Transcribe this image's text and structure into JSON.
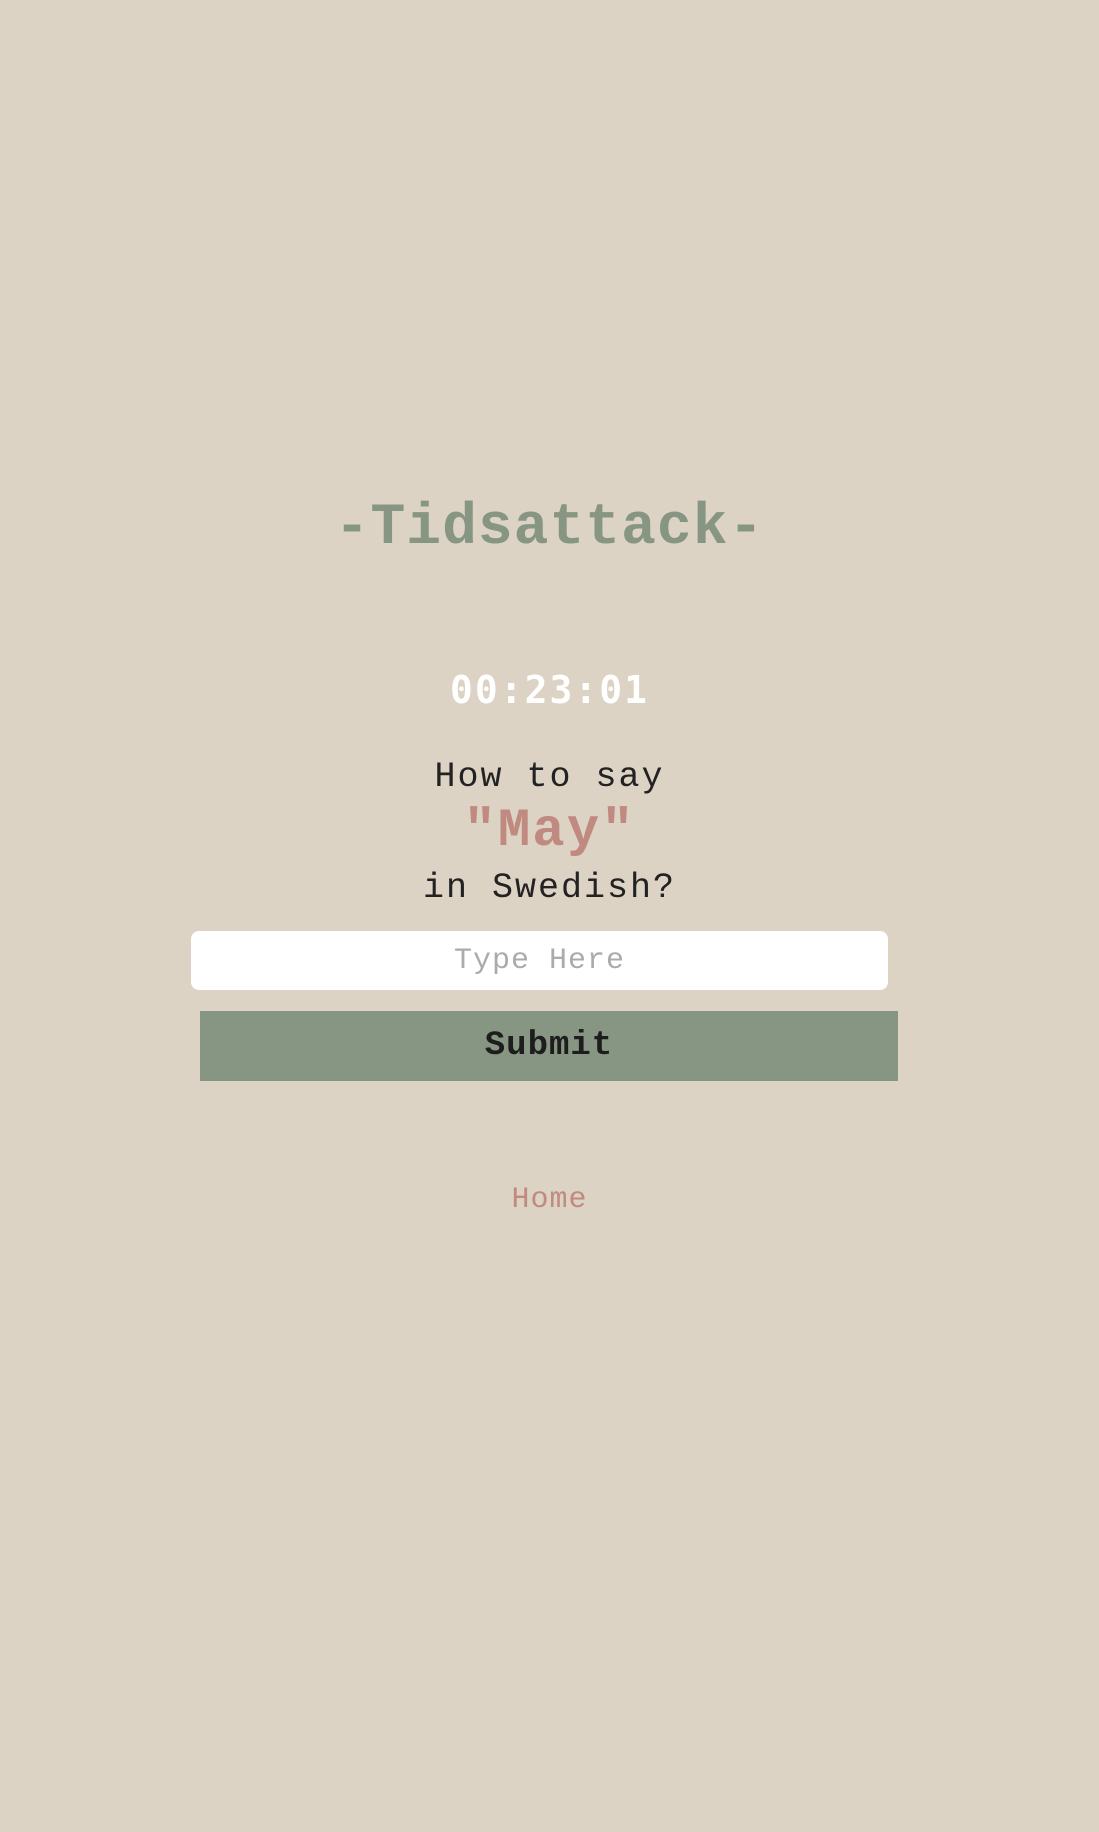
{
  "title": "-Tidsattack-",
  "timer": "00:23:01",
  "question": {
    "prefix": "How to say",
    "word": "\"May\"",
    "suffix": "in Swedish?"
  },
  "answer_input": {
    "value": "",
    "placeholder": "Type Here"
  },
  "submit_label": "Submit",
  "home_label": "Home",
  "colors": {
    "background": "#ddd3c5",
    "accent_green": "#879583",
    "accent_rose": "#c08a80",
    "timer_text": "#ffffff"
  }
}
